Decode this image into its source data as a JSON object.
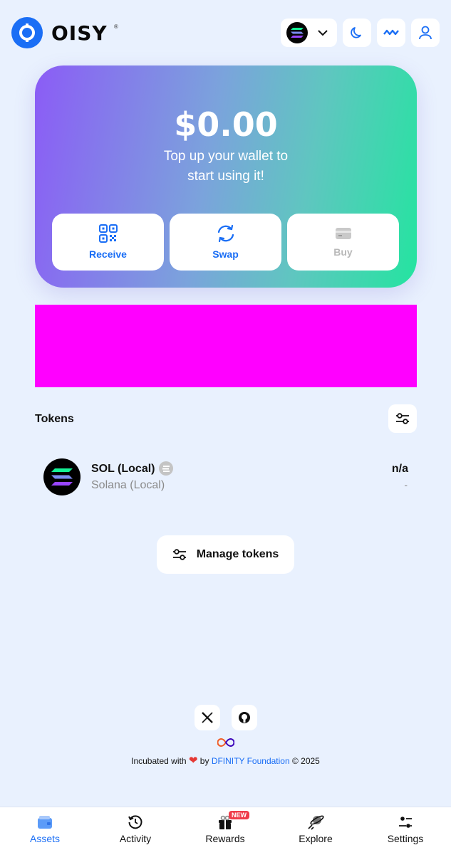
{
  "header": {
    "logo_text": "OISY",
    "logo_reg": "®",
    "network_icon": "solana-icon",
    "theme_icon": "moon-icon",
    "wave_icon": "wave-icon",
    "profile_icon": "user-icon"
  },
  "balance_card": {
    "amount": "$0.00",
    "message_line1": "Top up your wallet to",
    "message_line2": "start using it!",
    "actions": [
      {
        "label": "Receive",
        "icon": "qr-code-icon",
        "enabled": true
      },
      {
        "label": "Swap",
        "icon": "swap-icon",
        "enabled": true
      },
      {
        "label": "Buy",
        "icon": "card-icon",
        "enabled": false
      }
    ]
  },
  "tokens": {
    "title": "Tokens",
    "items": [
      {
        "name": "SOL (Local)",
        "network": "Solana (Local)",
        "balance": "n/a",
        "usd": "-"
      }
    ],
    "manage_label": "Manage tokens"
  },
  "footer": {
    "incubated_prefix": "Incubated with",
    "incubated_by": "by",
    "org": "DFINITY Foundation",
    "copyright": "© 2025"
  },
  "nav": {
    "items": [
      {
        "label": "Assets",
        "icon": "wallet-icon",
        "active": true
      },
      {
        "label": "Activity",
        "icon": "history-icon",
        "active": false
      },
      {
        "label": "Rewards",
        "icon": "gift-icon",
        "active": false
      },
      {
        "label": "Explore",
        "icon": "planet-icon",
        "active": false
      },
      {
        "label": "Settings",
        "icon": "sliders-icon",
        "active": false
      }
    ],
    "new_badge": "NEW"
  },
  "colors": {
    "accent": "#1a6ef5",
    "background": "#e9f1fe",
    "banner": "#ff00ff",
    "badge_red": "#ef3b4a"
  }
}
